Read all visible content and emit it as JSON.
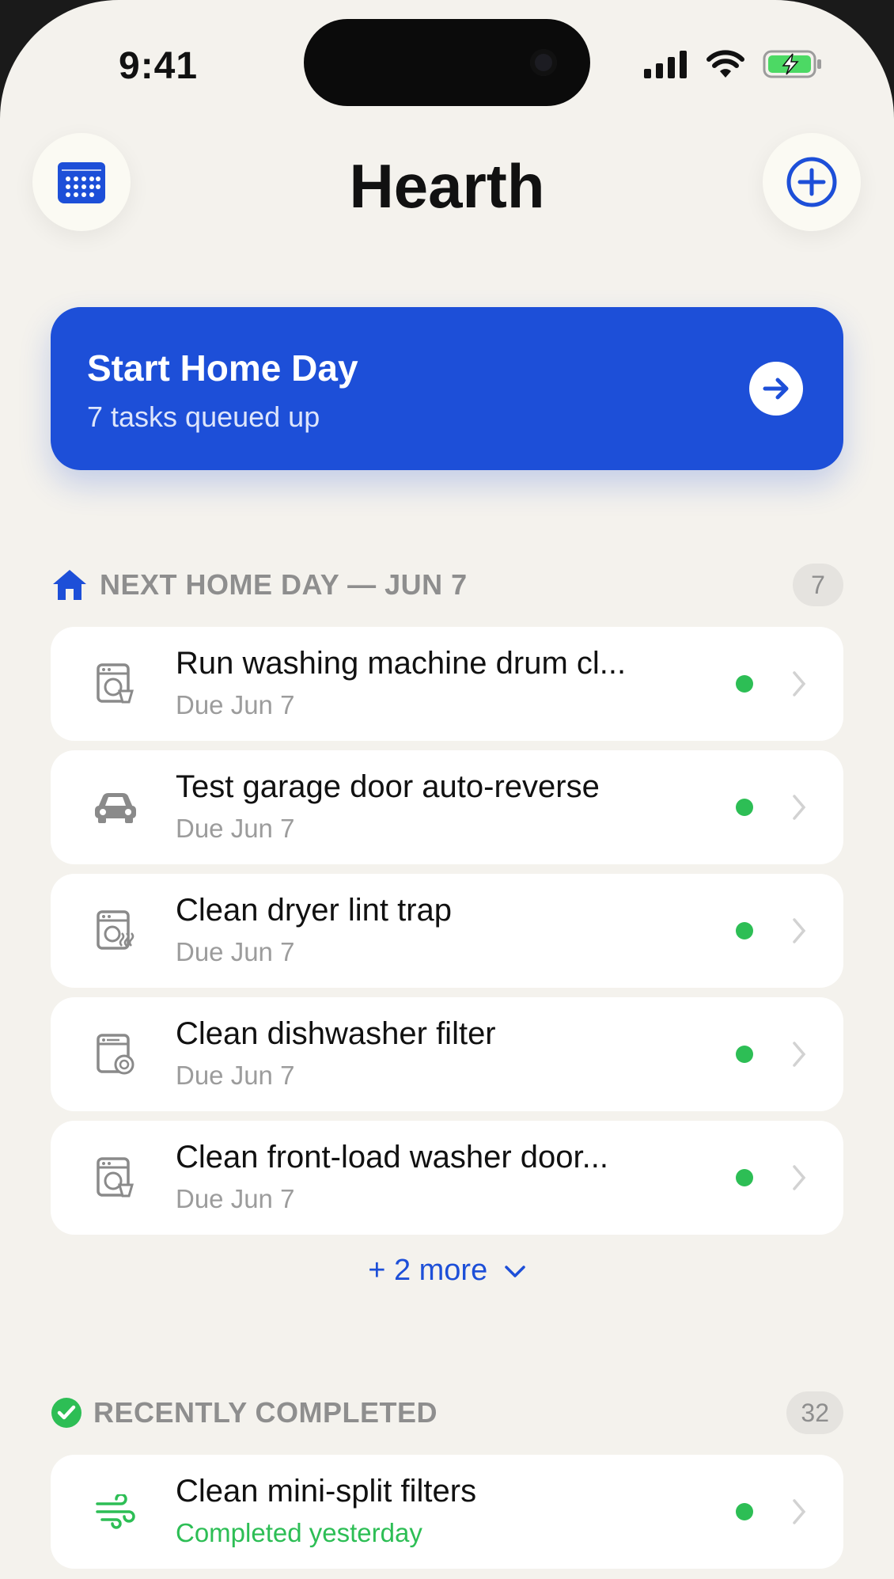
{
  "status_bar": {
    "time": "9:41"
  },
  "header": {
    "title": "Hearth"
  },
  "banner": {
    "title": "Start Home Day",
    "subtitle": "7 tasks queued up"
  },
  "next_section": {
    "label": "NEXT HOME DAY — JUN 7",
    "count": "7",
    "tasks": [
      {
        "title": "Run washing machine drum cl...",
        "due": "Due Jun 7",
        "icon": "washing-machine-icon"
      },
      {
        "title": "Test garage door auto-reverse",
        "due": "Due Jun 7",
        "icon": "car-icon"
      },
      {
        "title": "Clean dryer lint trap",
        "due": "Due Jun 7",
        "icon": "dryer-icon"
      },
      {
        "title": "Clean dishwasher filter",
        "due": "Due Jun 7",
        "icon": "dishwasher-icon"
      },
      {
        "title": "Clean front-load washer door...",
        "due": "Due Jun 7",
        "icon": "washing-machine-icon"
      }
    ],
    "more_label": "+ 2 more"
  },
  "completed_section": {
    "label": "RECENTLY COMPLETED",
    "count": "32",
    "tasks": [
      {
        "title": "Clean mini-split filters",
        "status": "Completed yesterday",
        "icon": "wind-icon"
      }
    ]
  },
  "colors": {
    "accent": "#1D4FD8",
    "status_green": "#2DBE55",
    "background": "#F4F2ED"
  }
}
